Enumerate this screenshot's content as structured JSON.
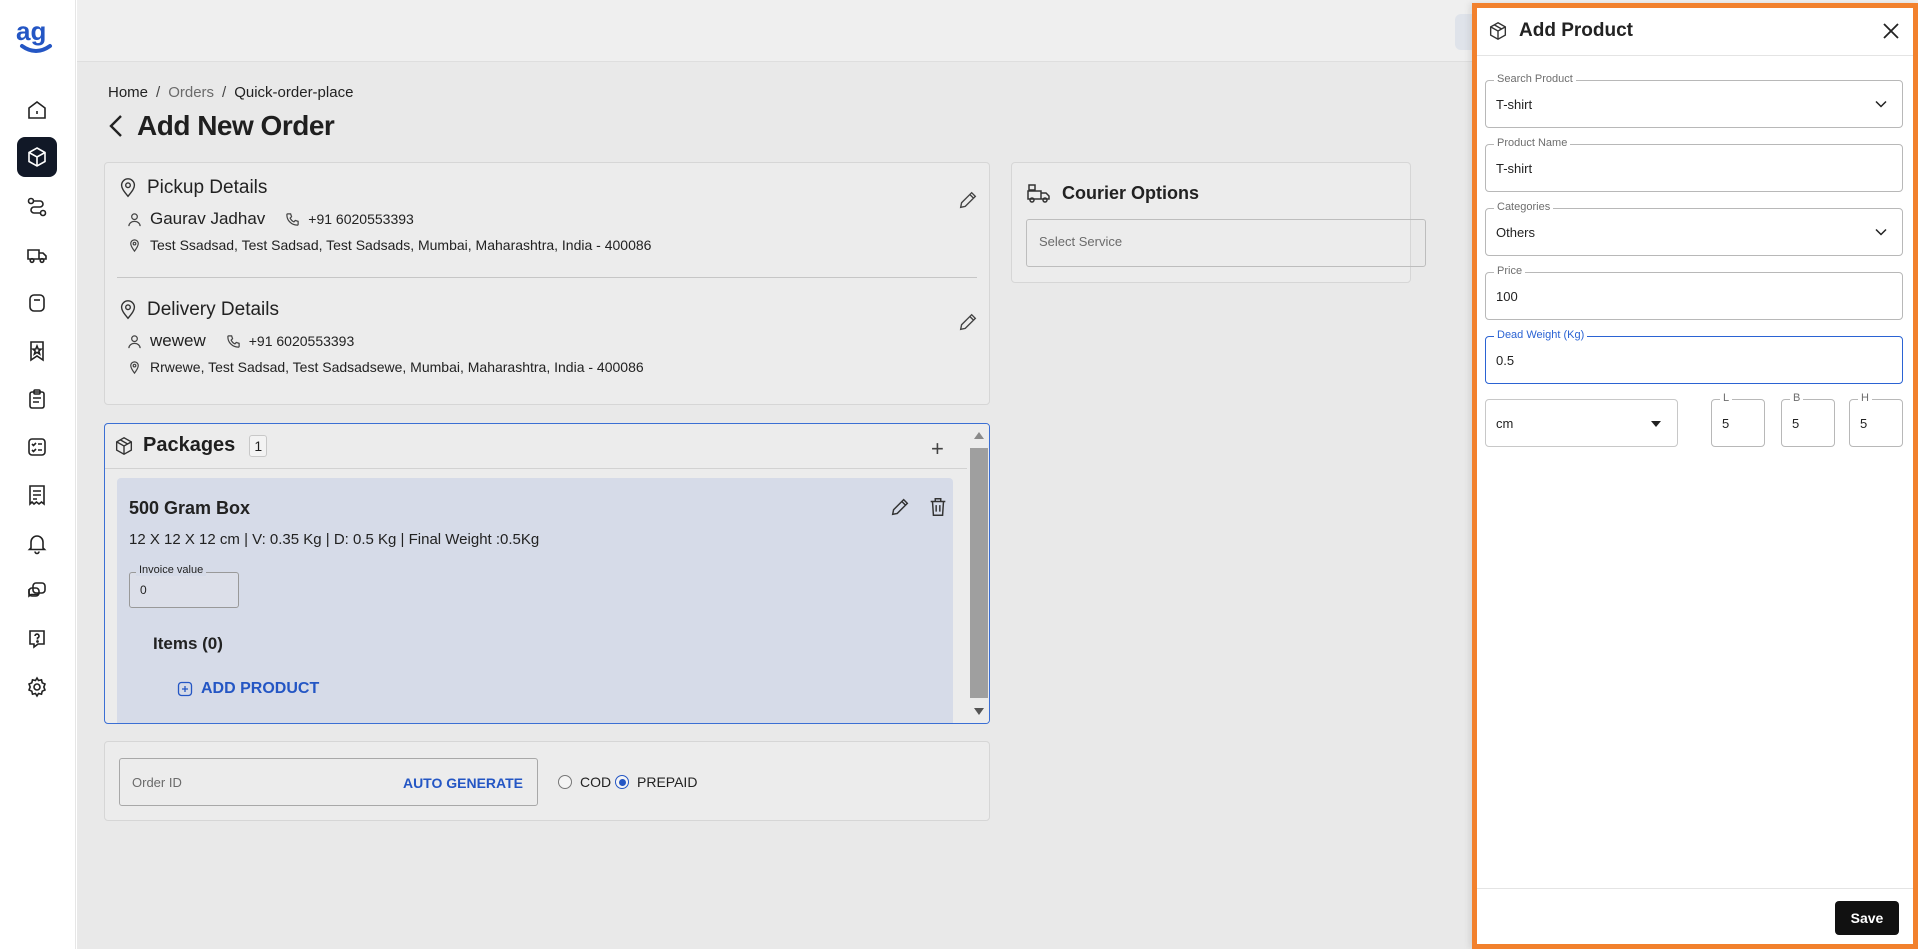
{
  "breadcrumb": {
    "home": "Home",
    "orders": "Orders",
    "current": "Quick-order-place",
    "sep": "/"
  },
  "page": {
    "title": "Add New Order"
  },
  "pickup": {
    "title": "Pickup Details",
    "name": "Gaurav Jadhav",
    "phone": "+91 6020553393",
    "address": "Test Ssadsad, Test Sadsad, Test Sadsads, Mumbai, Maharashtra, India - 400086"
  },
  "delivery": {
    "title": "Delivery Details",
    "name": "wewew",
    "phone": "+91 6020553393",
    "address": "Rrwewe, Test Sadsad, Test Sadsadsewe, Mumbai, Maharashtra, India - 400086"
  },
  "courier": {
    "title": "Courier Options",
    "placeholder": "Select Service"
  },
  "packages": {
    "title": "Packages",
    "count": "1",
    "box": {
      "name": "500 Gram Box",
      "dims": "12 X 12 X 12 cm | V: 0.35 Kg | D: 0.5 Kg | Final Weight :0.5Kg",
      "invoice_label": "Invoice value",
      "invoice_value": "0",
      "items_title": "Items (0)",
      "add_product": "ADD PRODUCT"
    }
  },
  "order": {
    "placeholder": "Order ID",
    "auto_generate": "AUTO GENERATE",
    "cod": "COD",
    "prepaid": "PREPAID",
    "selected": "PREPAID"
  },
  "drawer": {
    "title": "Add Product",
    "search_label": "Search Product",
    "search_value": "T-shirt",
    "name_label": "Product Name",
    "name_value": "T-shirt",
    "cat_label": "Categories",
    "cat_value": "Others",
    "price_label": "Price",
    "price_value": "100",
    "weight_label": "Dead Weight (Kg)",
    "weight_value": "0.5",
    "unit_value": "cm",
    "l_label": "L",
    "l_value": "5",
    "b_label": "B",
    "b_value": "5",
    "h_label": "H",
    "h_value": "5",
    "save": "Save"
  },
  "colors": {
    "accent": "#2456c4",
    "drawer_border": "#f2812d",
    "active_nav": "#111827"
  },
  "icons": [
    "home-icon",
    "box-icon",
    "route-icon",
    "truck-icon",
    "weight-icon",
    "star-badge-icon",
    "clipboard-icon",
    "checklist-icon",
    "receipt-icon",
    "bell-icon",
    "chat-icon",
    "help-icon",
    "gear-icon"
  ]
}
